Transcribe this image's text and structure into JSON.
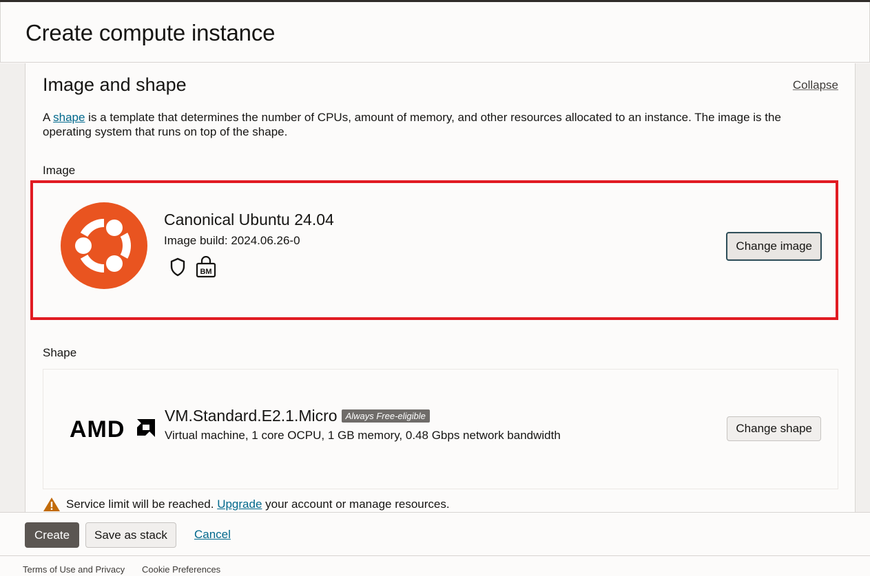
{
  "header": {
    "title": "Create compute instance"
  },
  "section": {
    "title": "Image and shape",
    "collapse_label": "Collapse",
    "desc_prefix": "A ",
    "desc_link": "shape",
    "desc_suffix": " is a template that determines the number of CPUs, amount of memory, and other resources allocated to an instance. The image is the operating system that runs on top of the shape."
  },
  "image": {
    "label": "Image",
    "name": "Canonical Ubuntu 24.04",
    "build": "Image build: 2024.06.26-0",
    "icons": [
      "shield-icon",
      "bare-metal-lock-icon"
    ],
    "bm_text": "BM",
    "change_label": "Change image",
    "logo_color": "#e95420"
  },
  "shape": {
    "label": "Shape",
    "name": "VM.Standard.E2.1.Micro",
    "badge": "Always Free-eligible",
    "description": "Virtual machine, 1 core OCPU, 1 GB memory, 0.48 Gbps network bandwidth",
    "change_label": "Change shape",
    "logo_text": "AMD"
  },
  "warning": {
    "prefix": "Service limit will be reached. ",
    "link": "Upgrade",
    "suffix": " your account or manage resources."
  },
  "actions": {
    "create": "Create",
    "save_stack": "Save as stack",
    "cancel": "Cancel"
  },
  "footer": {
    "terms": "Terms of Use and Privacy",
    "cookies": "Cookie Preferences"
  },
  "colors": {
    "highlight_border": "#e11b22",
    "link": "#00688c",
    "primary_button": "#5b5652",
    "warning_icon": "#c26b0a"
  }
}
